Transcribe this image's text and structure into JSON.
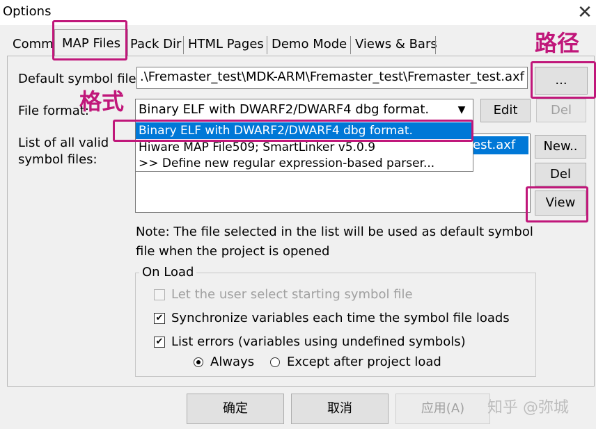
{
  "window": {
    "title": "Options"
  },
  "tabs": [
    {
      "label": "Comm"
    },
    {
      "label": "MAP Files"
    },
    {
      "label": "Pack Dir"
    },
    {
      "label": "HTML Pages"
    },
    {
      "label": "Demo Mode"
    },
    {
      "label": "Views & Bars"
    }
  ],
  "default_symbol": {
    "label": "Default symbol file:",
    "value": ".\\Fremaster_test\\MDK-ARM\\Fremaster_test\\Fremaster_test.axf",
    "browse": "..."
  },
  "file_format": {
    "label": "File format:",
    "value": "Binary ELF with DWARF2/DWARF4 dbg format.",
    "edit": "Edit",
    "del": "Del"
  },
  "dropdown": [
    "Binary ELF with DWARF2/DWARF4 dbg format.",
    "Hiware MAP File509; SmartLinker v5.0.9",
    ">> Define new regular expression-based parser..."
  ],
  "list": {
    "label": "List of all valid\nsymbol files:",
    "selected_suffix": "est.axf",
    "new": "New..",
    "del": "Del",
    "view": "View"
  },
  "note": "Note: The file selected in the list will be used as default symbol file when the project is opened",
  "on_load": {
    "title": "On Load",
    "options": [
      {
        "label": "Let the user select starting symbol file",
        "checked": false,
        "disabled": true
      },
      {
        "label": "Synchronize variables each time the symbol file loads",
        "checked": true,
        "disabled": false
      },
      {
        "label": "List errors (variables using undefined symbols)",
        "checked": true,
        "disabled": false
      }
    ],
    "radios": [
      {
        "label": "Always",
        "selected": true
      },
      {
        "label": "Except after project load",
        "selected": false
      }
    ]
  },
  "footer": {
    "ok": "确定",
    "cancel": "取消",
    "apply": "应用(A)"
  },
  "annotations": {
    "path": "路径",
    "format": "格式"
  },
  "watermark": "知乎 @弥城",
  "colors": {
    "highlight": "#c0177a",
    "selection": "#0078d7"
  }
}
